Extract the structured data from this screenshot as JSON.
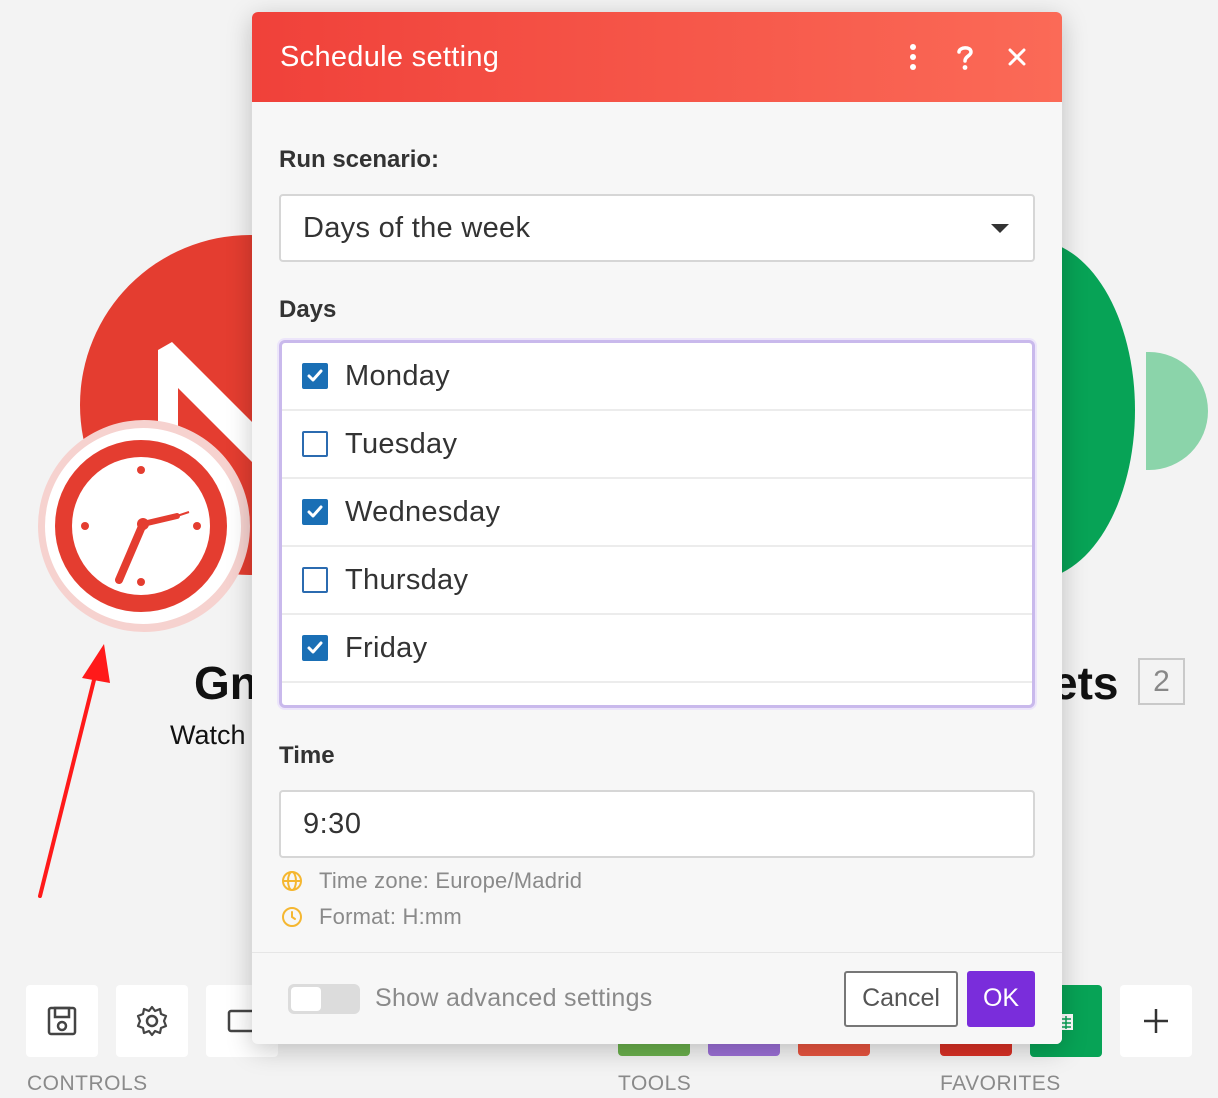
{
  "colors": {
    "header_start": "#f0413a",
    "header_end": "#fb6a57",
    "checkbox_checked": "#1a6fb5",
    "focus_border": "#c9b9ec",
    "ok_button": "#7a2ddb",
    "hint_icon": "#f5b731",
    "module_red": "#e43d30",
    "module_green": "#07a356"
  },
  "background": {
    "module_left_title": "Gn",
    "module_left_subtitle": "Watch",
    "module_right_title": "ets",
    "module_right_badge": "2",
    "toolbar": {
      "controls_label": "CONTROLS",
      "tools_label": "TOOLS",
      "favorites_label": "FAVORITES",
      "icons": [
        "save-icon",
        "gear-icon",
        "notes-icon",
        "sheets-icon",
        "plus-icon"
      ]
    }
  },
  "modal": {
    "title": "Schedule setting",
    "header_icons": [
      "more-vertical-icon",
      "help-icon",
      "close-icon"
    ],
    "run_label": "Run scenario:",
    "run_value": "Days of the week",
    "days_label": "Days",
    "days": [
      {
        "label": "Monday",
        "checked": true
      },
      {
        "label": "Tuesday",
        "checked": false
      },
      {
        "label": "Wednesday",
        "checked": true
      },
      {
        "label": "Thursday",
        "checked": false
      },
      {
        "label": "Friday",
        "checked": true
      }
    ],
    "time_label": "Time",
    "time_value": "9:30",
    "timezone_hint": "Time zone: Europe/Madrid",
    "format_hint": "Format: H:mm",
    "advanced_label": "Show advanced settings",
    "advanced_on": false,
    "cancel_label": "Cancel",
    "ok_label": "OK"
  }
}
